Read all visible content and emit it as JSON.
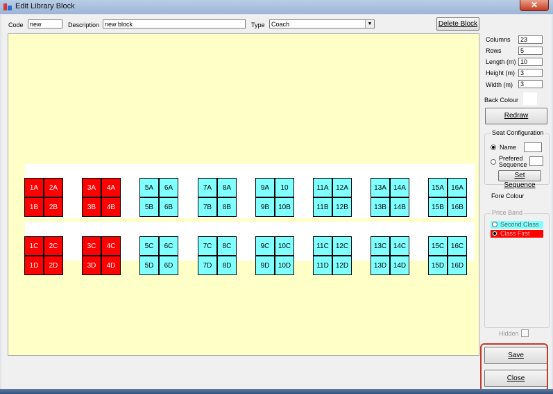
{
  "window": {
    "title": "Edit Library Block",
    "close_glyph": "✕"
  },
  "toolbar": {
    "code_label": "Code",
    "code_value": "new",
    "description_label": "Description",
    "description_value": "new block",
    "type_label": "Type",
    "type_value": "Coach",
    "delete_label": "Delete Block"
  },
  "panel": {
    "columns_label": "Columns",
    "columns_value": "23",
    "rows_label": "Rows",
    "rows_value": "5",
    "length_label": "Length (m)",
    "length_value": "10",
    "height_label": "Height (m)",
    "height_value": "3",
    "width_label": "Width (m)",
    "width_value": "3",
    "back_colour_label": "Back Colour",
    "redraw_label": "Redraw",
    "seat_config_title": "Seat Configuration",
    "name_label": "Name",
    "prefered_label": "Prefered",
    "sequence_label": "Sequence",
    "set_sequence_label": "Set Sequence",
    "fore_colour_label": "Fore Colour",
    "price_band_title": "Price Band",
    "band_second": "Second Class",
    "band_first": "Class First",
    "hidden_label": "Hidden",
    "save_label": "Save",
    "close_label": "Close"
  },
  "colors": {
    "first_class": "#ff0000",
    "second_class": "#80ffff",
    "canvas": "#ffffc8",
    "highlight": "#c0392b"
  },
  "seat_rows": {
    "top_row1": [
      "1A",
      "2A",
      "3A",
      "4A",
      "5A",
      "6A",
      "7A",
      "8A",
      "9A",
      "10",
      "11A",
      "12A",
      "13A",
      "14A",
      "15A",
      "16A"
    ],
    "top_row2": [
      "1B",
      "2B",
      "3B",
      "4B",
      "5B",
      "6B",
      "7B",
      "8B",
      "9B",
      "10B",
      "11B",
      "12B",
      "13B",
      "14B",
      "15B",
      "16B"
    ],
    "bot_row1": [
      "1C",
      "2C",
      "3C",
      "4C",
      "5C",
      "6C",
      "7C",
      "8C",
      "9C",
      "10C",
      "11C",
      "12C",
      "13C",
      "14C",
      "15C",
      "16C"
    ],
    "bot_row2": [
      "1D",
      "2D",
      "3D",
      "4D",
      "5D",
      "6D",
      "7D",
      "8D",
      "9D",
      "10D",
      "11D",
      "12D",
      "13D",
      "14D",
      "15D",
      "16D"
    ],
    "first_class_count": 4
  }
}
